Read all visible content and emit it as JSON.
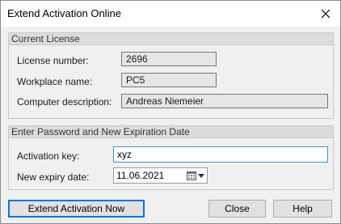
{
  "window": {
    "title": "Extend Activation Online"
  },
  "current_license": {
    "header": "Current License",
    "license_number_label": "License number:",
    "license_number_value": "2696",
    "workplace_label": "Workplace name:",
    "workplace_value": "PC5",
    "description_label": "Computer description:",
    "description_value": "Andreas Niemeier"
  },
  "new_expiration": {
    "header": "Enter Password and New Expiration Date",
    "activation_key_label": "Activation key:",
    "activation_key_value": "xyz",
    "expiry_label": "New expiry date:",
    "expiry_value": "11.06.2021"
  },
  "buttons": {
    "extend": "Extend Activation Now",
    "close": "Close",
    "help": "Help"
  },
  "icons": {
    "close": "close-icon",
    "calendar": "calendar-icon",
    "dropdown": "chevron-down-icon"
  },
  "colors": {
    "focus_border": "#3b95c7",
    "default_button_border": "#0078d7"
  }
}
